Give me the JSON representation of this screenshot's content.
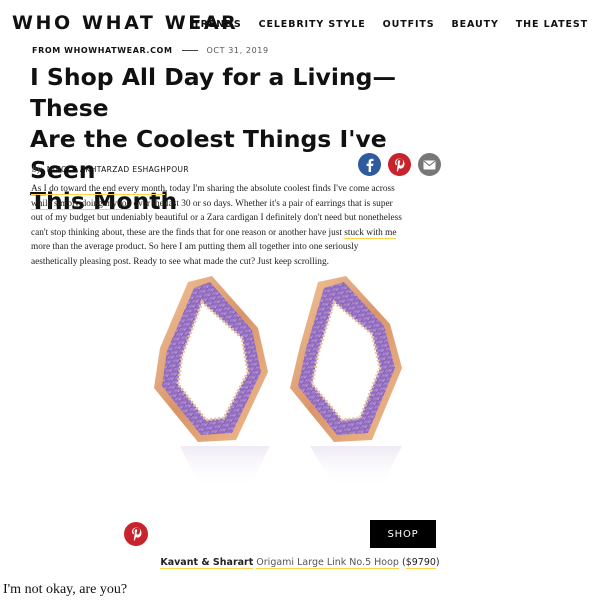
{
  "header": {
    "logo": "WHO WHAT WEAR",
    "nav": [
      "TRENDS",
      "CELEBRITY STYLE",
      "OUTFITS",
      "BEAUTY",
      "THE LATEST"
    ]
  },
  "article": {
    "source": "FROM WHOWHATWEAR.COM",
    "date": "OCT 31, 2019",
    "title_lines": [
      "I Shop All Day for a Living—These",
      "Are the Coolest Things I've Seen",
      "This Month"
    ],
    "byline_prefix": "by",
    "author": "NICOLE AKHTARZAD ESHAGHPOUR",
    "body": {
      "t1": "",
      "link1": "As I do toward the end every month",
      "t2": ", today I'm sharing the absolute coolest finds I've come across ",
      "link2": "while simply doing my job",
      "t3": " over the last 30 or so days. Whether it's a pair of earrings that is super out of my budget but undeniably beautiful or a Zara cardigan I definitely don't need but nonetheless can't stop thinking about, these are the finds that for one reason or another have just ",
      "link3": "stuck with me",
      "t4": " more than the average product. So here I am putting them all together into one seriously aesthetically pleasing post. Ready to see what made the cut? Just keep scrolling."
    }
  },
  "share_icons": [
    "facebook-icon",
    "pinterest-icon",
    "email-icon"
  ],
  "product": {
    "image_subject": "amethyst-earrings",
    "shop_label": "SHOP",
    "brand": "Kavant & Sharart",
    "name": "Origami Large Link No.5 Hoop",
    "price_open": " (",
    "price": "$9790",
    "price_close": ")"
  },
  "overlay_text": "I'm not okay, are you?",
  "colors": {
    "facebook": "#2e5a9e",
    "pinterest": "#c8232c",
    "email": "#777777",
    "link_underline": "#ffd24a",
    "shop_button": "#000000"
  }
}
